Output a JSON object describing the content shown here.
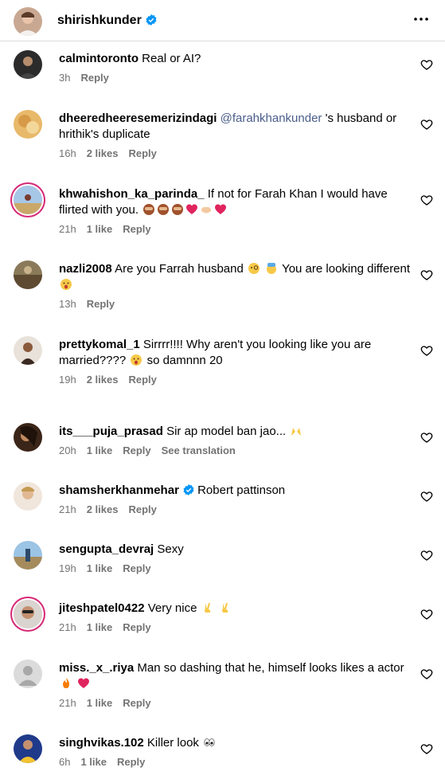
{
  "header": {
    "username": "shirishkunder",
    "verified": true
  },
  "comments": [
    {
      "username": "calmintoronto",
      "text": "Real or AI?",
      "time": "3h",
      "likes": "",
      "reply": "Reply",
      "translation": ""
    },
    {
      "username": "dheeredheeresemerizindagi",
      "mention": "@farahkhankunder",
      "text": " 's husband or hrithik's duplicate",
      "time": "16h",
      "likes": "2 likes",
      "reply": "Reply",
      "translation": ""
    },
    {
      "username": "khwahishon_ka_parinda_",
      "text": "If not for Farah Khan I would have flirted with you.",
      "time": "21h",
      "likes": "1 like",
      "reply": "Reply",
      "translation": ""
    },
    {
      "username": "nazli2008",
      "text": "Are you Farrah husband",
      "text2": "You are looking different",
      "time": "13h",
      "likes": "",
      "reply": "Reply",
      "translation": ""
    },
    {
      "username": "prettykomal_1",
      "text": "Sirrrr!!!! Why aren't you looking like you are married????",
      "text2": "so damnnn 20",
      "time": "19h",
      "likes": "2 likes",
      "reply": "Reply",
      "translation": ""
    },
    {
      "username": "its___puja_prasad",
      "text": "Sir ap model ban jao...",
      "time": "20h",
      "likes": "1 like",
      "reply": "Reply",
      "translation": "See translation"
    },
    {
      "username": "shamsherkhanmehar",
      "text": "Robert pattinson",
      "time": "21h",
      "likes": "2 likes",
      "reply": "Reply",
      "translation": ""
    },
    {
      "username": "sengupta_devraj",
      "text": "Sexy",
      "time": "19h",
      "likes": "1 like",
      "reply": "Reply",
      "translation": ""
    },
    {
      "username": "jiteshpatel0422",
      "text": "Very nice",
      "time": "21h",
      "likes": "1 like",
      "reply": "Reply",
      "translation": ""
    },
    {
      "username": "miss._x_.riya",
      "text": "Man so dashing that he, himself looks likes a actor",
      "time": "21h",
      "likes": "1 like",
      "reply": "Reply",
      "translation": ""
    },
    {
      "username": "singhvikas.102",
      "text": "Killer look",
      "time": "6h",
      "likes": "1 like",
      "reply": "Reply",
      "translation": ""
    }
  ],
  "colors": {
    "meta": "#737373",
    "mention": "#4a5d8a",
    "verified": "#0095f6",
    "story_ring": "#d62976"
  }
}
